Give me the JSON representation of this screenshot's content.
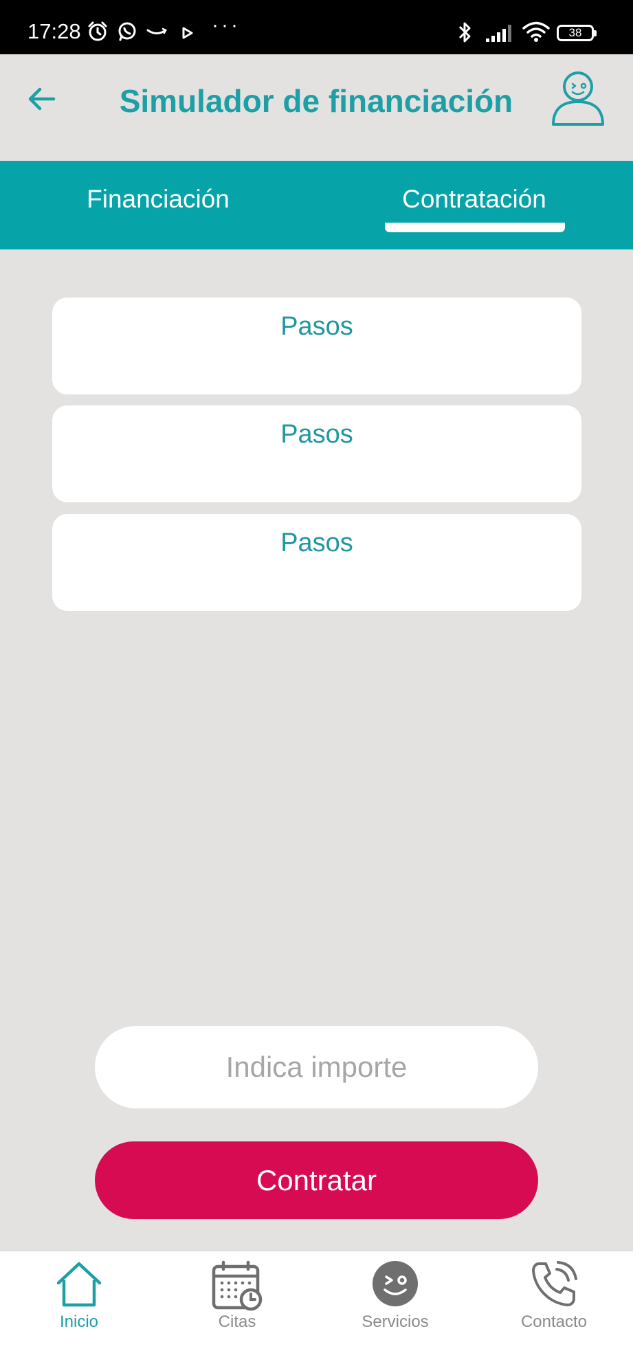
{
  "status_bar": {
    "time": "17:28",
    "battery": "38",
    "icons": [
      "alarm-icon",
      "whatsapp-icon",
      "amazon-icon",
      "play-icon",
      "more-dots-icon",
      "bluetooth-icon",
      "signal-icon",
      "wifi-icon",
      "battery-icon"
    ],
    "dots": "···"
  },
  "header": {
    "title": "Simulador de financiación",
    "back_icon": "back-arrow-icon",
    "profile_icon": "profile-icon"
  },
  "tabs": [
    {
      "label": "Financiación",
      "active": false
    },
    {
      "label": "Contratación",
      "active": true
    }
  ],
  "cards": [
    {
      "title": "Pasos"
    },
    {
      "title": "Pasos"
    },
    {
      "title": "Pasos"
    }
  ],
  "amount_input": {
    "placeholder": "Indica importe",
    "value": ""
  },
  "contract_button": {
    "label": "Contratar"
  },
  "bottom_nav": [
    {
      "label": "Inicio",
      "icon": "home-icon",
      "active": true
    },
    {
      "label": "Citas",
      "icon": "calendar-icon",
      "active": false
    },
    {
      "label": "Servicios",
      "icon": "services-icon",
      "active": false
    },
    {
      "label": "Contacto",
      "icon": "phone-icon",
      "active": false
    }
  ],
  "colors": {
    "accent": "#06a3a8",
    "title": "#1d9fa6",
    "primary_button": "#d60b52",
    "background": "#e3e2e1"
  }
}
